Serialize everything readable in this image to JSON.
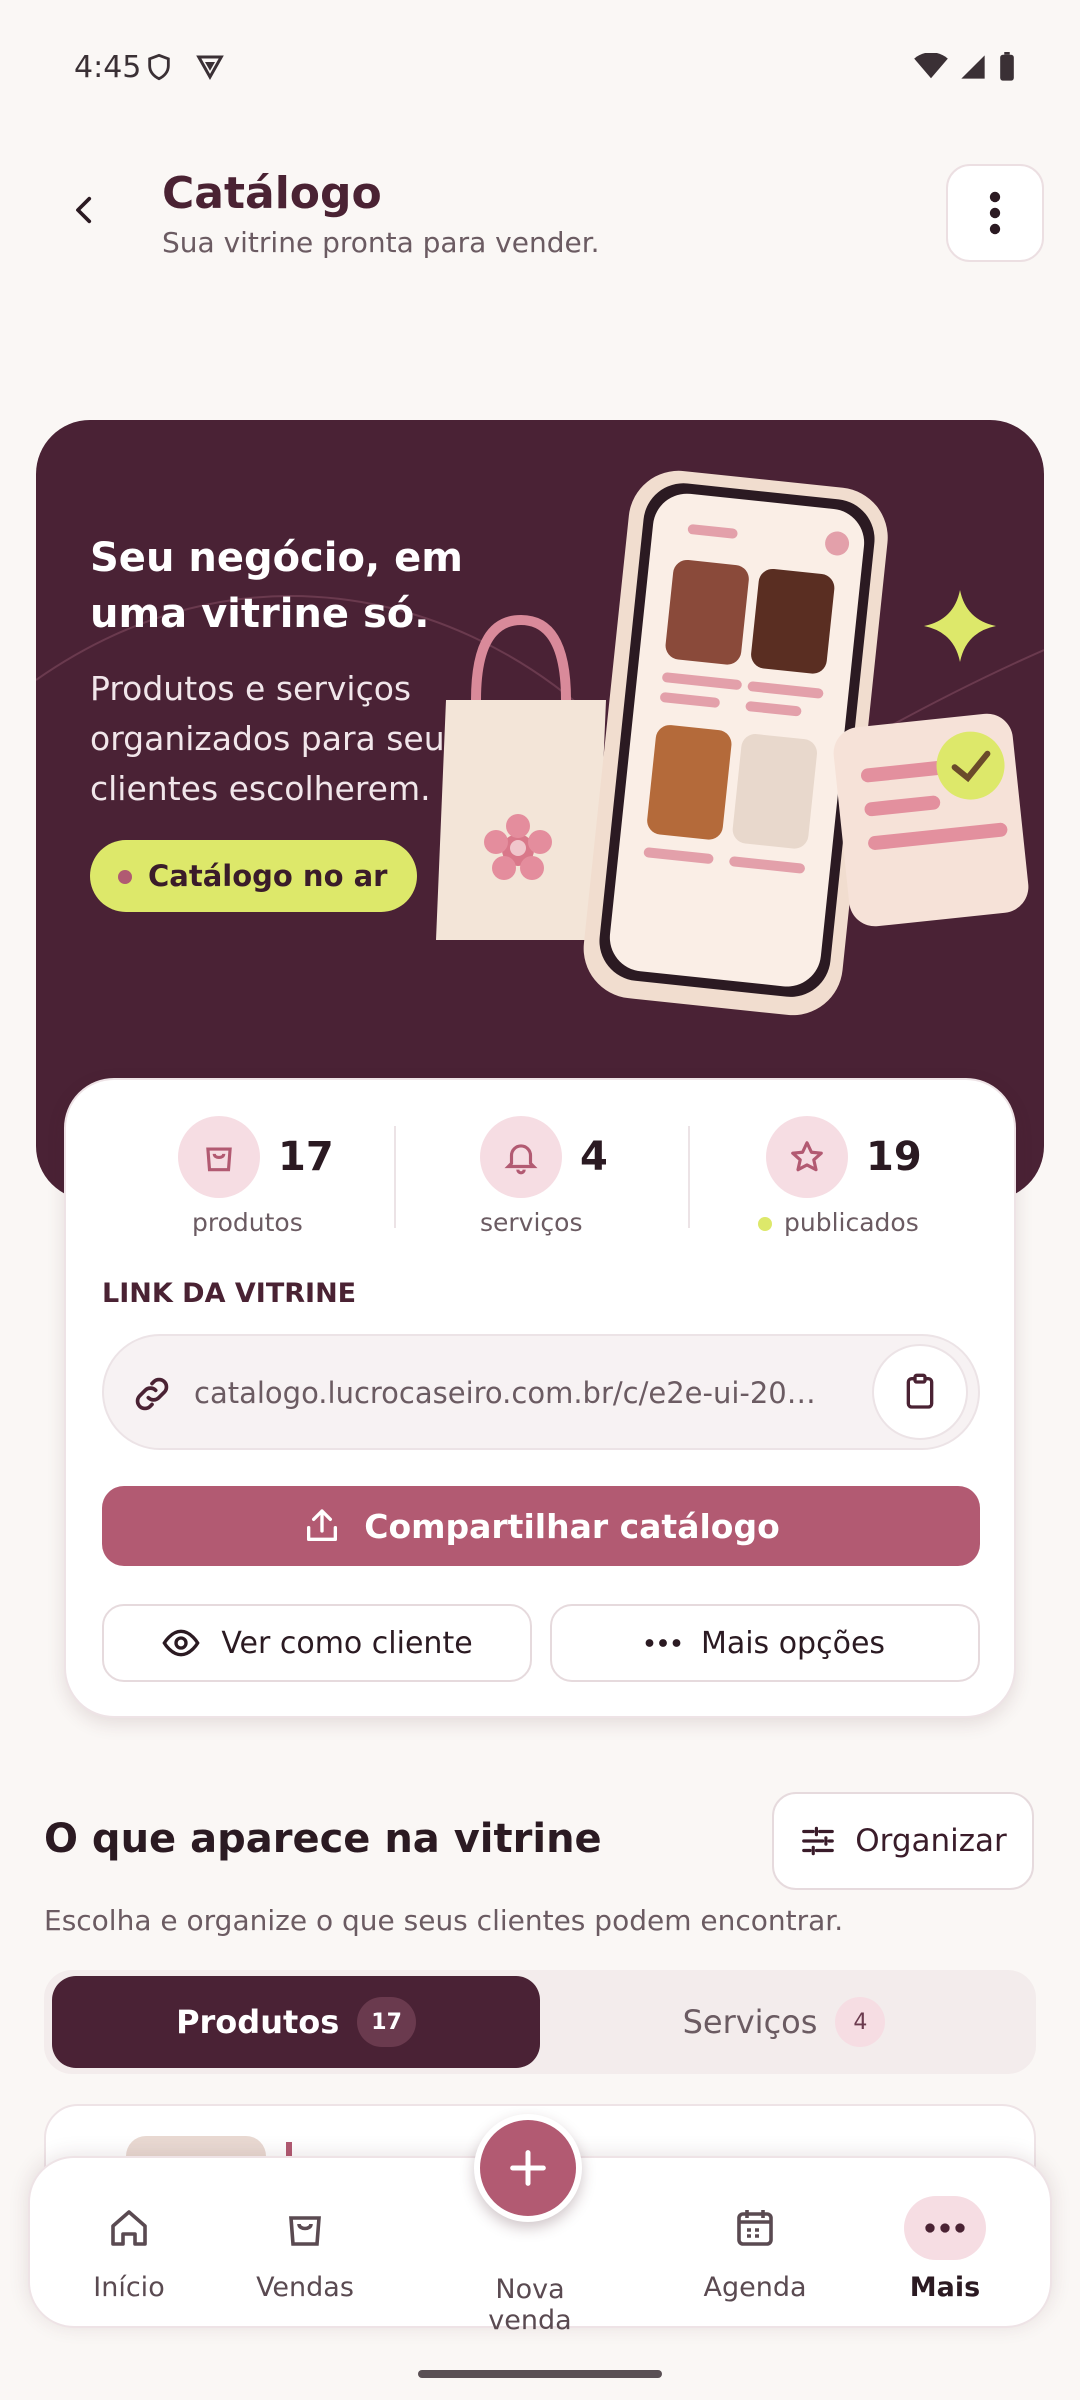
{
  "status_bar": {
    "time": "4:45"
  },
  "header": {
    "title": "Catálogo",
    "subtitle": "Sua vitrine pronta para vender."
  },
  "hero": {
    "title": "Seu negócio, em uma vitrine só.",
    "description": "Produtos e serviços organizados para seus clientes escolherem.",
    "pill": "Catálogo no ar"
  },
  "stats": [
    {
      "value": "17",
      "label": "produtos",
      "icon": "bag-icon"
    },
    {
      "value": "4",
      "label": "serviços",
      "icon": "bell-icon"
    },
    {
      "value": "19",
      "label": "publicados",
      "icon": "star-icon"
    }
  ],
  "link": {
    "label": "LINK DA VITRINE",
    "url": "catalogo.lucrocaseiro.com.br/c/e2e-ui-2026..."
  },
  "actions": {
    "share": "Compartilhar catálogo",
    "view_as_client": "Ver como cliente",
    "more_options": "Mais opções"
  },
  "section": {
    "title": "O que aparece na vitrine",
    "subtitle": "Escolha e organize o que seus clientes podem encontrar.",
    "organize": "Organizar"
  },
  "tabs": [
    {
      "label": "Produtos",
      "count": "17",
      "active": true
    },
    {
      "label": "Serviços",
      "count": "4",
      "active": false
    }
  ],
  "bottom_nav": {
    "items": [
      "Início",
      "Vendas",
      "Nova venda",
      "Agenda",
      "Mais"
    ],
    "active": "Mais"
  },
  "colors": {
    "primary": "#4a2235",
    "accent": "#b25a72",
    "lime": "#dde86a",
    "pink_soft": "#f6dde3"
  }
}
